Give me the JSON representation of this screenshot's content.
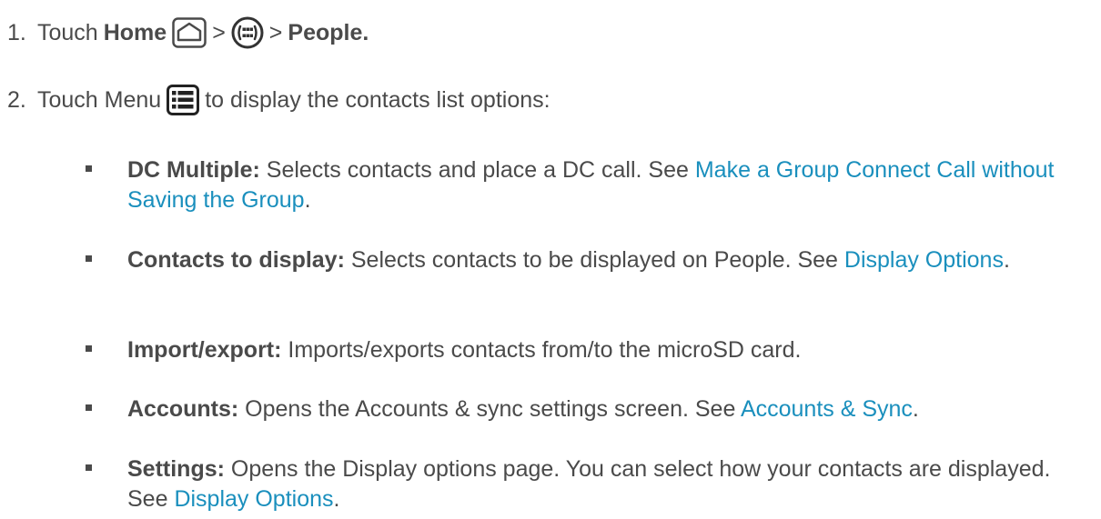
{
  "step1": {
    "number": "1.",
    "text_touch": "Touch",
    "home": "Home",
    "sep1": ">",
    "sep2": ">",
    "people": "People.",
    "icons": [
      "home-icon",
      "apps-icon"
    ]
  },
  "step2": {
    "number": "2.",
    "text_before": "Touch Menu",
    "text_after": "to display the contacts list options:",
    "icons": [
      "menu-icon"
    ]
  },
  "bullets": [
    {
      "label": "DC Multiple:",
      "text": " Selects contacts and place a DC call. See ",
      "link": "Make a Group Connect Call without Saving the Group",
      "after": "."
    },
    {
      "label": "Contacts to display:",
      "text": " Selects contacts to be displayed on People. See ",
      "link": "Display Options",
      "after": "."
    },
    {
      "label": "Import/export:",
      "text": " Imports/exports contacts from/to the microSD card.",
      "link": "",
      "after": ""
    },
    {
      "label": "Accounts:",
      "text": " Opens the Accounts & sync settings screen. See ",
      "link": "Accounts & Sync",
      "after": "."
    },
    {
      "label": "Settings:",
      "text": " Opens the Display options page. You can select how your contacts are displayed. See ",
      "link": "Display Options",
      "after": "."
    }
  ],
  "colors": {
    "text": "#4a4a4a",
    "link": "#1a8fbd"
  }
}
